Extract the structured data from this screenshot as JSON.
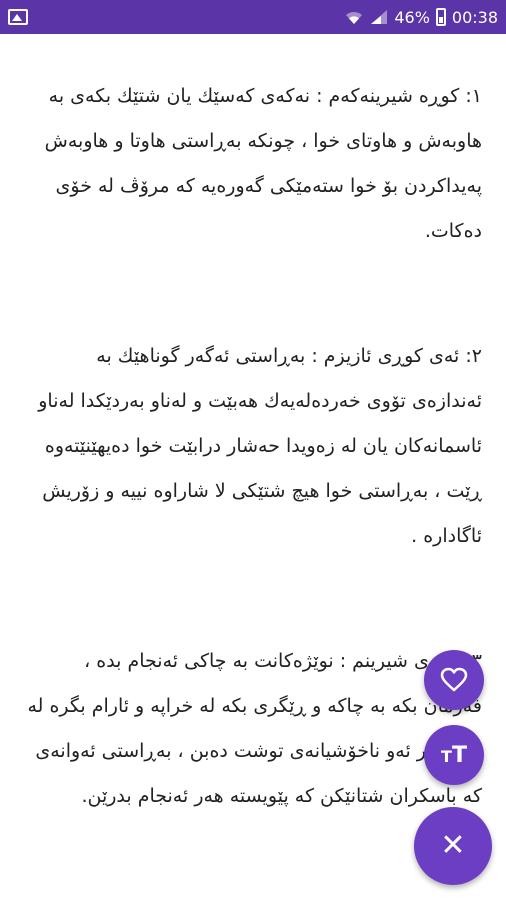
{
  "status_bar": {
    "battery": "46%",
    "time": "00:38"
  },
  "content": {
    "paragraphs": [
      "١: کوڕە شیرینەکەم : نەکەی کەسێك یان شتێك بکەی بە هاوبەش و هاوتای خوا ، چونکە بەڕاستی هاوتا و هاوبەش پەیداکردن بۆ خوا ستەمێکی گەورەیە کە مرۆڤ لە خۆی دەکات.",
      "٢: ئەی کوڕی ئازیزم : بەڕاستی ئەگەر گوناهێك بە ئەندازەی تۆوی خەردەلەیەك هەبێت و لەناو بەردێکدا لەناو ئاسمانەکان یان لە زەویدا حەشار درابێت خوا دەیهێنێتەوە ڕێت ، بەڕاستی خوا هیچ شتێکی لا شاراوە نییە و زۆریش ئاگادارە .",
      "٣: کوڕی شیرینم : نوێژەکانت بە چاکی ئەنجام بدە ، فەرمان بکە بە چاکە و ڕێگری بکە لە خراپە و ئارام بگرە لە بەرامبەر ئەو ناخۆشیانەی توشت دەبن ، بەڕاستی ئەوانەی کە باسکران شتانێکن کە پێویستە هەر ئەنجام بدرێن."
    ]
  },
  "icons": {
    "gallery": "gallery-icon",
    "wifi": "wifi-icon",
    "signal": "signal-icon",
    "battery": "battery-icon",
    "favorite": "heart-icon",
    "text_size": "text-size-icon",
    "close": "close-icon"
  },
  "colors": {
    "status_bar": "#5b34a8",
    "fab": "#6c3ec4",
    "text": "#222222"
  }
}
